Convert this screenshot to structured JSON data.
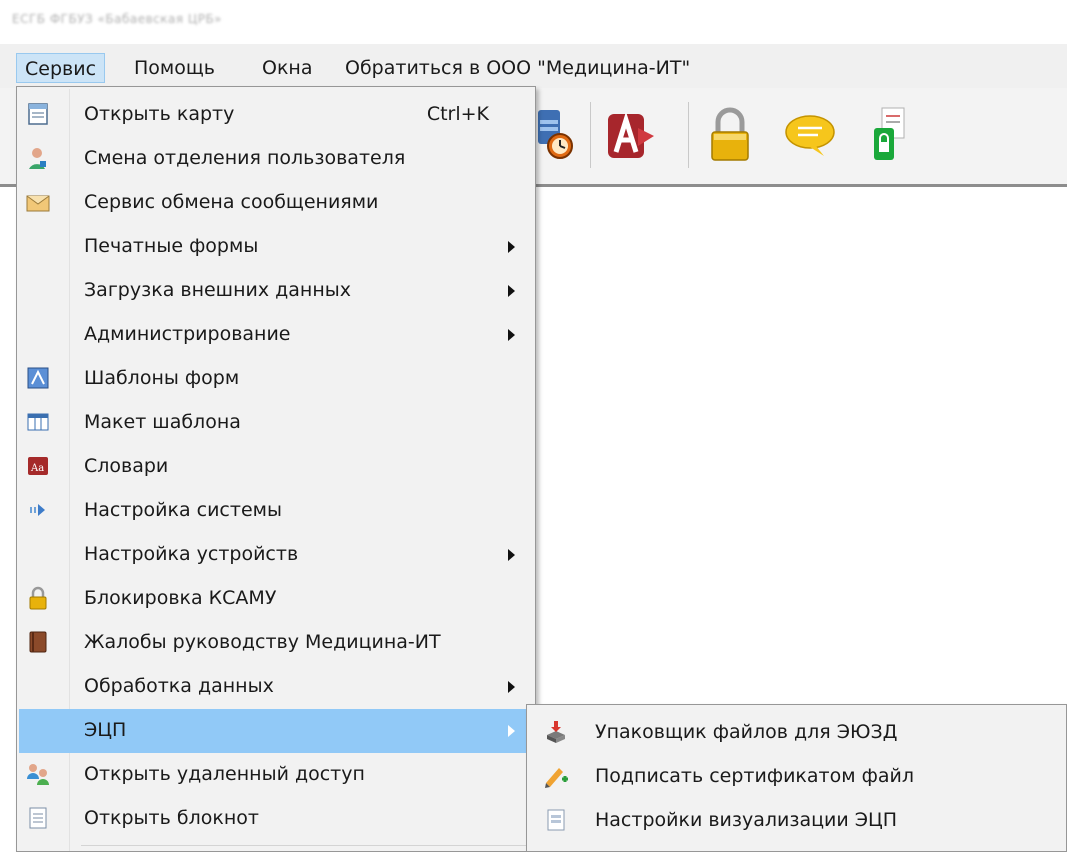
{
  "window": {
    "title": "ЕСГБ ФГБУЗ «Бабаевская ЦРБ»"
  },
  "menubar": {
    "items": [
      {
        "label": "Сервис",
        "active": true
      },
      {
        "label": "Помощь"
      },
      {
        "label": "Окна"
      },
      {
        "label": "Обратиться в ООО \"Медицина-ИТ\""
      }
    ]
  },
  "toolbar": {
    "icons": [
      "calendar-clock-icon",
      "access-db-icon",
      "padlock-icon",
      "speech-bubble-icon",
      "usb-certificate-icon"
    ]
  },
  "menu": {
    "items": [
      {
        "label": "Открыть карту",
        "shortcut": "Ctrl+K",
        "icon": "card-file-icon"
      },
      {
        "label": "Смена отделения пользователя",
        "icon": "doctor-icon"
      },
      {
        "label": "Сервис обмена сообщениями",
        "icon": "envelope-icon"
      },
      {
        "label": "Печатные формы",
        "submenu": true
      },
      {
        "label": "Загрузка внешних данных",
        "submenu": true
      },
      {
        "label": "Администрирование",
        "submenu": true
      },
      {
        "label": "Шаблоны форм",
        "icon": "form-template-icon"
      },
      {
        "label": "Макет шаблона",
        "icon": "grid-layout-icon"
      },
      {
        "label": "Словари",
        "icon": "dictionary-icon"
      },
      {
        "label": "Настройка системы",
        "icon": "arrow-right-icon"
      },
      {
        "label": "Настройка устройств",
        "submenu": true
      },
      {
        "label": "Блокировка КСАМУ",
        "icon": "lock-icon"
      },
      {
        "label": "Жалобы руководству Медицина-ИТ",
        "icon": "book-icon"
      },
      {
        "label": "Обработка данных",
        "submenu": true
      },
      {
        "label": "ЭЦП",
        "submenu": true,
        "highlighted": true
      },
      {
        "label": "Открыть удаленный доступ",
        "icon": "remote-access-icon"
      },
      {
        "label": "Открыть блокнот",
        "icon": "notepad-icon"
      }
    ]
  },
  "submenu_ecp": {
    "items": [
      {
        "label": "Упаковщик файлов для ЭЮЗД",
        "icon": "packer-icon"
      },
      {
        "label": "Подписать сертификатом файл",
        "icon": "pen-sign-icon"
      },
      {
        "label": "Настройки визуализации ЭЦП",
        "icon": "settings-doc-icon"
      }
    ]
  },
  "colors": {
    "highlight": "#91c9f7",
    "menu_bg": "#f2f2f2",
    "active_menu": "#cce4f7"
  }
}
